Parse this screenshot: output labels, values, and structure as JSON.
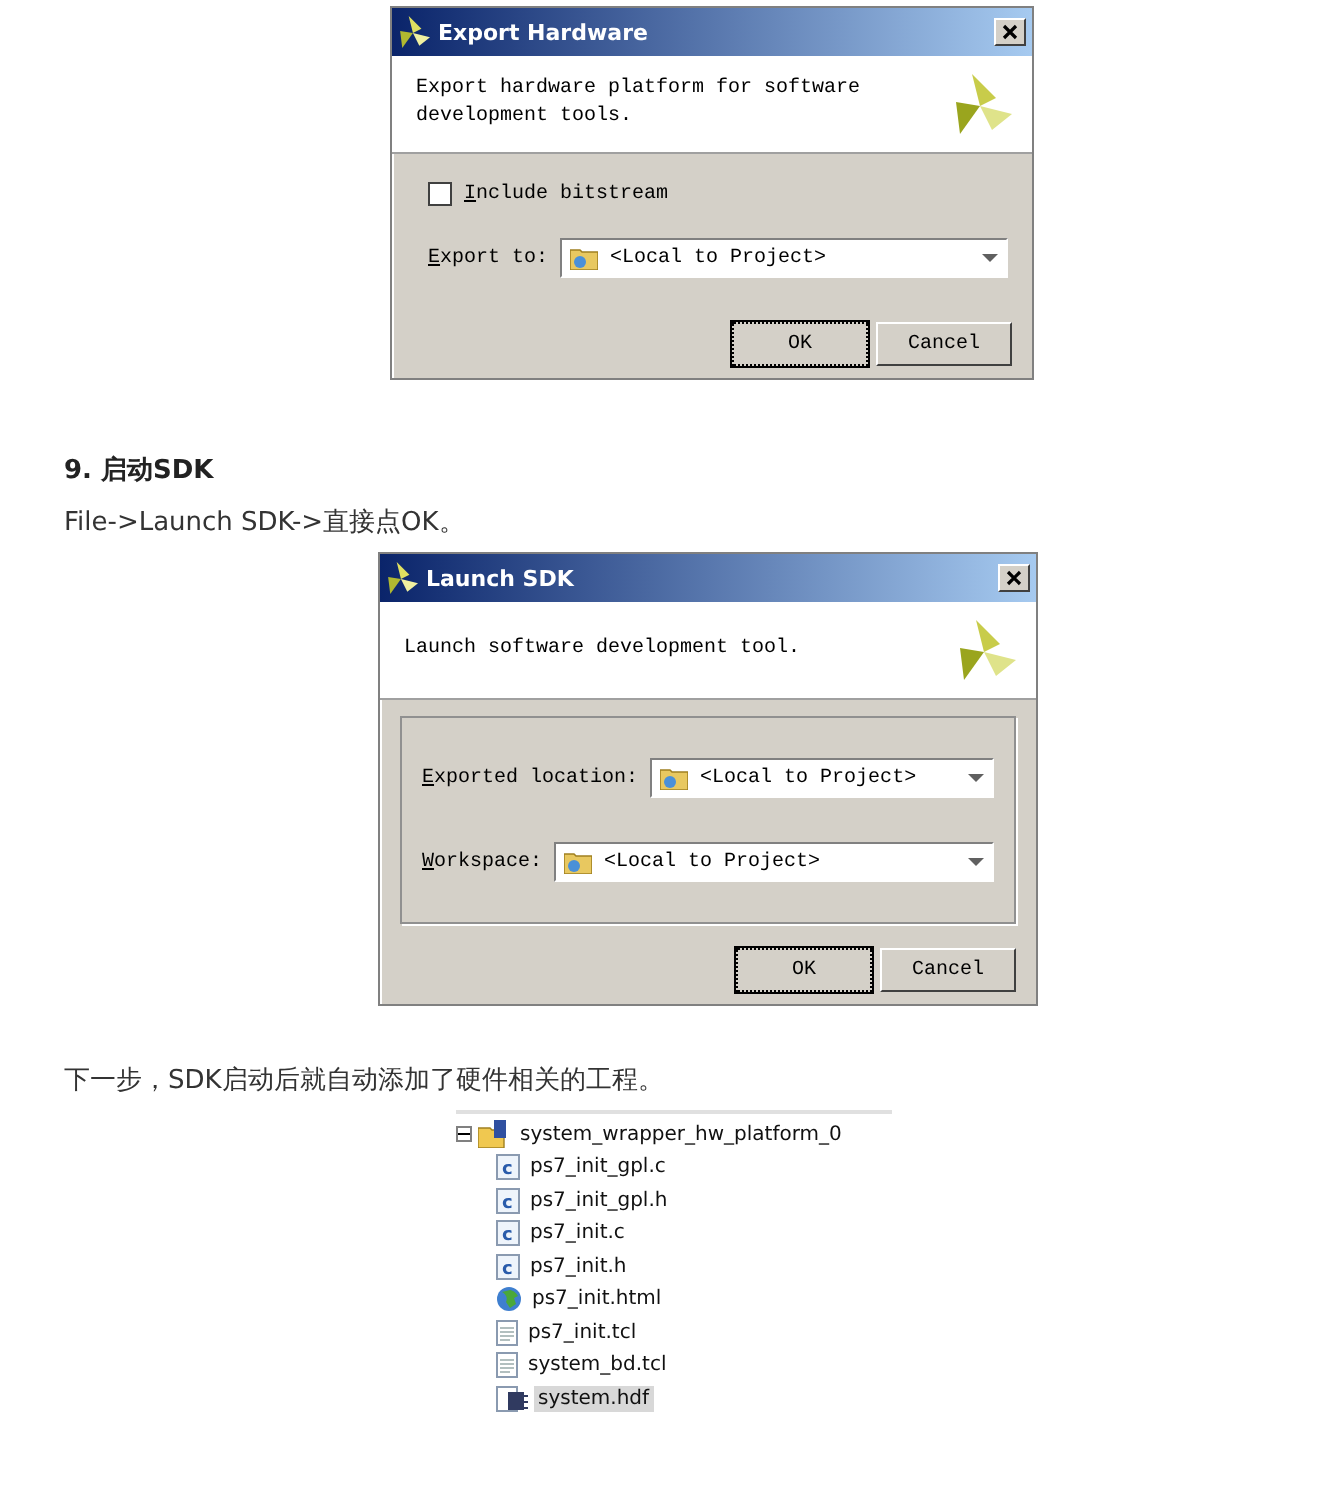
{
  "article": [
    {
      "kind": "dialog",
      "title": "Export Hardware",
      "description": "Export hardware platform for software development tools.",
      "grouped": false,
      "fields": [
        {
          "kind": "checkbox",
          "label": "Include bitstream",
          "checked": false
        },
        {
          "kind": "dropdown",
          "label": "Export to:",
          "value": "<Local to Project>"
        }
      ],
      "buttons": [
        {
          "label": "OK",
          "default": true
        },
        {
          "label": "Cancel",
          "default": false
        }
      ]
    },
    {
      "kind": "heading",
      "text": "9. 启动SDK"
    },
    {
      "kind": "paragraph",
      "text": "File->Launch SDK->直接点OK。"
    },
    {
      "kind": "dialog",
      "title": "Launch SDK",
      "description": "Launch software development tool.",
      "grouped": true,
      "fields": [
        {
          "kind": "dropdown",
          "label": "Exported location:",
          "value": "<Local to Project>"
        },
        {
          "kind": "dropdown",
          "label": "Workspace:",
          "value": "<Local to Project>"
        }
      ],
      "buttons": [
        {
          "label": "OK",
          "default": true
        },
        {
          "label": "Cancel",
          "default": false
        }
      ]
    },
    {
      "kind": "paragraph",
      "text": "下一步，SDK启动后就自动添加了硬件相关的工程。"
    },
    {
      "kind": "tree",
      "items": [
        {
          "label": "system_wrapper_hw_platform_0",
          "kind": "project",
          "expanded": true,
          "selected": false,
          "children": [
            {
              "label": "ps7_init_gpl.c",
              "kind": "c",
              "selected": false
            },
            {
              "label": "ps7_init_gpl.h",
              "kind": "c",
              "selected": false
            },
            {
              "label": "ps7_init.c",
              "kind": "c",
              "selected": false
            },
            {
              "label": "ps7_init.h",
              "kind": "c",
              "selected": false
            },
            {
              "label": "ps7_init.html",
              "kind": "web",
              "selected": false
            },
            {
              "label": "ps7_init.tcl",
              "kind": "text",
              "selected": false
            },
            {
              "label": "system_bd.tcl",
              "kind": "text",
              "selected": false
            },
            {
              "label": "system.hdf",
              "kind": "hardware",
              "selected": true
            }
          ]
        }
      ]
    }
  ]
}
